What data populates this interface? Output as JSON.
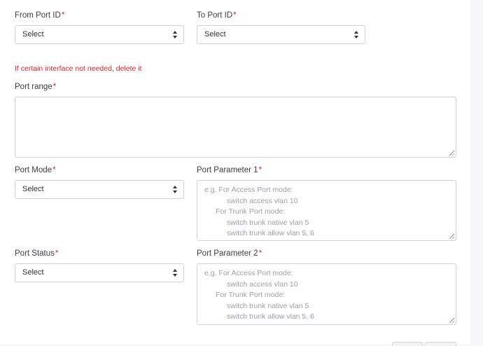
{
  "form": {
    "from_port": {
      "label": "From Port ID",
      "required": "*",
      "value": "Select"
    },
    "to_port": {
      "label": "To Port ID",
      "required": "*",
      "value": "Select"
    },
    "warning": "If certain interface not needed, delete it",
    "port_range": {
      "label": "Port range",
      "required": "*",
      "value": ""
    },
    "port_mode": {
      "label": "Port Mode",
      "required": "*",
      "value": "Select"
    },
    "port_param1": {
      "label": "Port Parameter 1",
      "required": "*",
      "placeholder_lines": [
        "e.g. For Access Port mode:",
        "switch access vlan 10",
        "For Trunk Port mode:",
        "switch trunk native vlan 5",
        "switch trunk allow vlan 5, 6"
      ]
    },
    "port_status": {
      "label": "Port Status",
      "required": "*",
      "value": "Select"
    },
    "port_param2": {
      "label": "Port Parameter 2",
      "required": "*",
      "placeholder_lines": [
        "e.g. For Access Port mode:",
        "switch access vlan 10",
        "For Trunk Port mode:",
        "switch trunk native vlan 5",
        "switch trunk allow vlan 5, 6"
      ]
    }
  },
  "icons": {
    "select_caret": "up-down-caret-icon",
    "resize_grip": "resize-grip-icon"
  },
  "colors": {
    "required": "#e0232b",
    "warning": "#e0232b",
    "placeholder": "#9aa1a8",
    "border": "#cfd4da"
  }
}
